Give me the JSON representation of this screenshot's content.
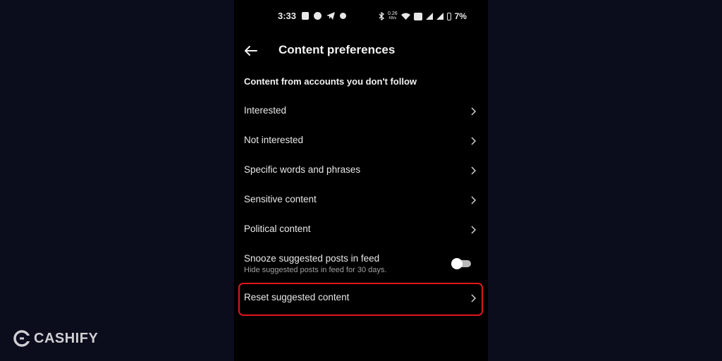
{
  "status_bar": {
    "time": "3:33",
    "speed_value": "0.26",
    "speed_unit": "KB/s",
    "battery": "7%"
  },
  "header": {
    "title": "Content preferences"
  },
  "section": {
    "heading": "Content from accounts you don't follow"
  },
  "items": [
    {
      "label": "Interested"
    },
    {
      "label": "Not interested"
    },
    {
      "label": "Specific words and phrases"
    },
    {
      "label": "Sensitive content"
    },
    {
      "label": "Political content"
    }
  ],
  "snooze": {
    "title": "Snooze suggested posts in feed",
    "subtitle": "Hide suggested posts in feed for 30 days.",
    "enabled": false
  },
  "reset": {
    "label": "Reset suggested content",
    "highlight_color": "#e0161c"
  },
  "watermark": {
    "text": "CASHIFY"
  },
  "colors": {
    "page_bg": "#0b0c1c",
    "screen_bg": "#000000",
    "text": "#e9e9e9",
    "subtext": "#a0a0a0"
  }
}
